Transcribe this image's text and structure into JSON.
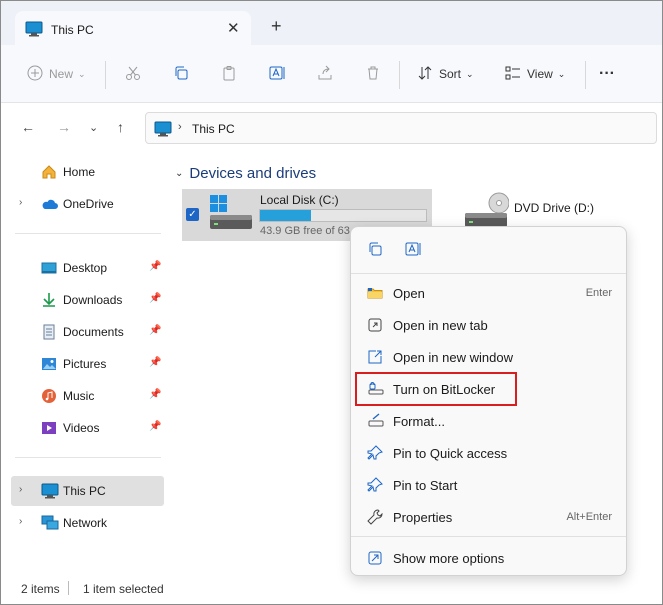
{
  "tab": {
    "title": "This PC",
    "close": "✕",
    "new_tab": "+"
  },
  "toolbar": {
    "new_label": "New",
    "sort_label": "Sort",
    "view_label": "View",
    "more": "···"
  },
  "address": {
    "separator": "›",
    "path": "This PC"
  },
  "sidebar": {
    "items": [
      {
        "label": "Home"
      },
      {
        "label": "OneDrive"
      },
      {
        "label": "Desktop"
      },
      {
        "label": "Downloads"
      },
      {
        "label": "Documents"
      },
      {
        "label": "Pictures"
      },
      {
        "label": "Music"
      },
      {
        "label": "Videos"
      },
      {
        "label": "This PC"
      },
      {
        "label": "Network"
      }
    ]
  },
  "content": {
    "section_title": "Devices and drives",
    "drive_c": {
      "name": "Local Disk (C:)",
      "free": "43.9 GB free of 63",
      "used_fraction": 0.31
    },
    "drive_d": {
      "name": "DVD Drive (D:)"
    }
  },
  "status": {
    "count": "2 items",
    "selection": "1 item selected"
  },
  "context_menu": {
    "items": [
      {
        "label": "Open",
        "shortcut": "Enter"
      },
      {
        "label": "Open in new tab",
        "shortcut": ""
      },
      {
        "label": "Open in new window",
        "shortcut": ""
      },
      {
        "label": "Turn on BitLocker",
        "shortcut": ""
      },
      {
        "label": "Format...",
        "shortcut": ""
      },
      {
        "label": "Pin to Quick access",
        "shortcut": ""
      },
      {
        "label": "Pin to Start",
        "shortcut": ""
      },
      {
        "label": "Properties",
        "shortcut": "Alt+Enter"
      },
      {
        "label": "Show more options",
        "shortcut": ""
      }
    ]
  },
  "colors": {
    "accent": "#1d66c6",
    "highlight": "#d81e1e",
    "progress": "#26a0da"
  }
}
